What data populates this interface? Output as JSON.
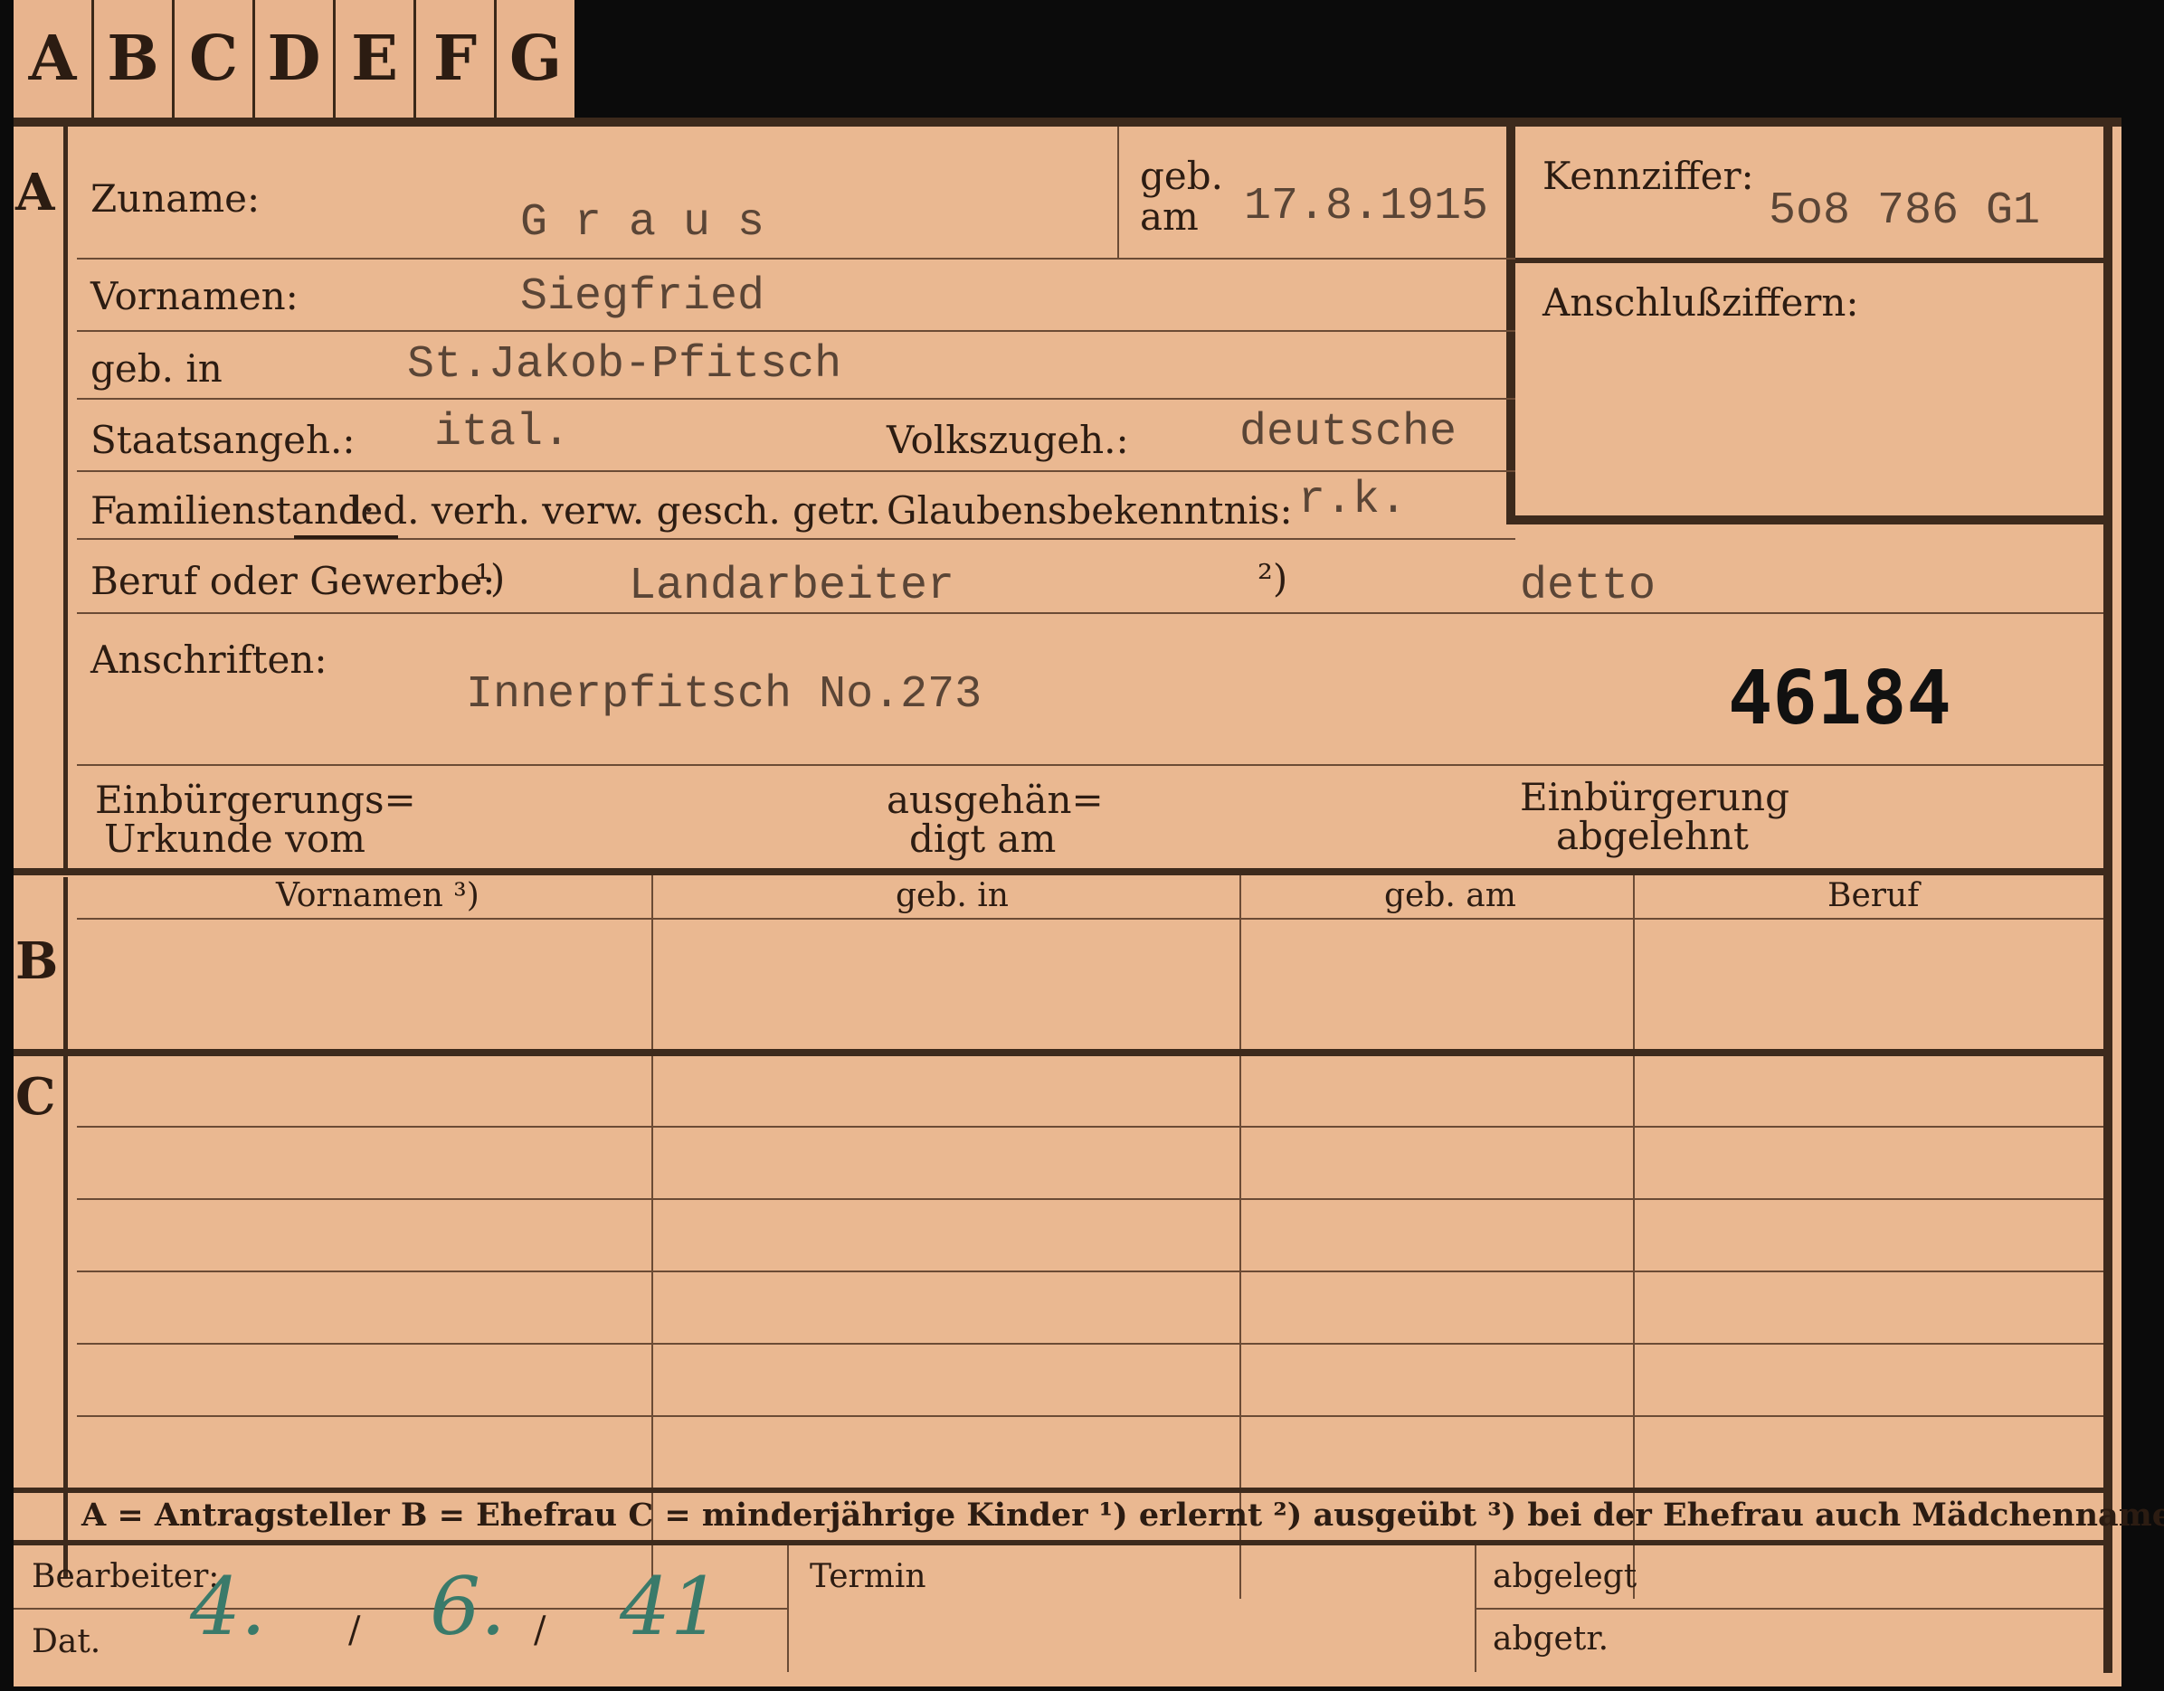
{
  "tabs": [
    "A",
    "B",
    "C",
    "D",
    "E",
    "F",
    "G"
  ],
  "sections": {
    "a": "A",
    "b": "B",
    "c": "C"
  },
  "labels": {
    "zuname": "Zuname:",
    "geb": "geb.",
    "am": "am",
    "vornamen": "Vornamen:",
    "geb_in": "geb. in",
    "staatsangeh": "Staatsangeh.:",
    "volkszugeh": "Volkszugeh.:",
    "familienstand": "Familienstand:",
    "familienstand_options": "led. verh. verw. gesch. getr.",
    "glaubensbekenntnis": "Glaubensbekenntnis:",
    "beruf": "Beruf oder Gewerbe:",
    "note1": "¹)",
    "note2": "²)",
    "anschriften": "Anschriften:",
    "einb_urkunde_1": "Einbürgerungs=",
    "einb_urkunde_2": "Urkunde vom",
    "ausgehaen_1": "ausgehän=",
    "ausgehaen_2": "digt am",
    "einb_abgelehnt_1": "Einbürgerung",
    "einb_abgelehnt_2": "abgelehnt",
    "kennziffer": "Kennziffer:",
    "anschlussziffern": "Anschlußziffern:"
  },
  "values": {
    "zuname": "G r a u s",
    "geb_am": "17.8.1915",
    "kennziffer": "5o8 786  G1",
    "vornamen": "Siegfried",
    "geb_in": "St.Jakob-Pfitsch",
    "staatsangeh": "ital.",
    "volkszugeh": "deutsche",
    "glaubensbekenntnis": "r.k.",
    "beruf_erlernt": "Landarbeiter",
    "beruf_ausgeuebt": "detto",
    "anschrift": "Innerpfitsch No.273",
    "stamp_number": "46184"
  },
  "table_headers": [
    "Vornamen ³)",
    "geb. in",
    "geb. am",
    "Beruf"
  ],
  "legend": "A = Antragsteller   B = Ehefrau   C = minderjährige Kinder   ¹) erlernt   ²) ausgeübt   ³) bei der Ehefrau auch Mädchenname",
  "footer": {
    "bearbeiter": "Bearbeiter:",
    "dat": "Dat.",
    "termin": "Termin",
    "abgelegt": "abgelegt",
    "abgetr": "abgetr.",
    "date_day": "4.",
    "date_month": "6.",
    "date_year": "41",
    "sep": "/"
  }
}
